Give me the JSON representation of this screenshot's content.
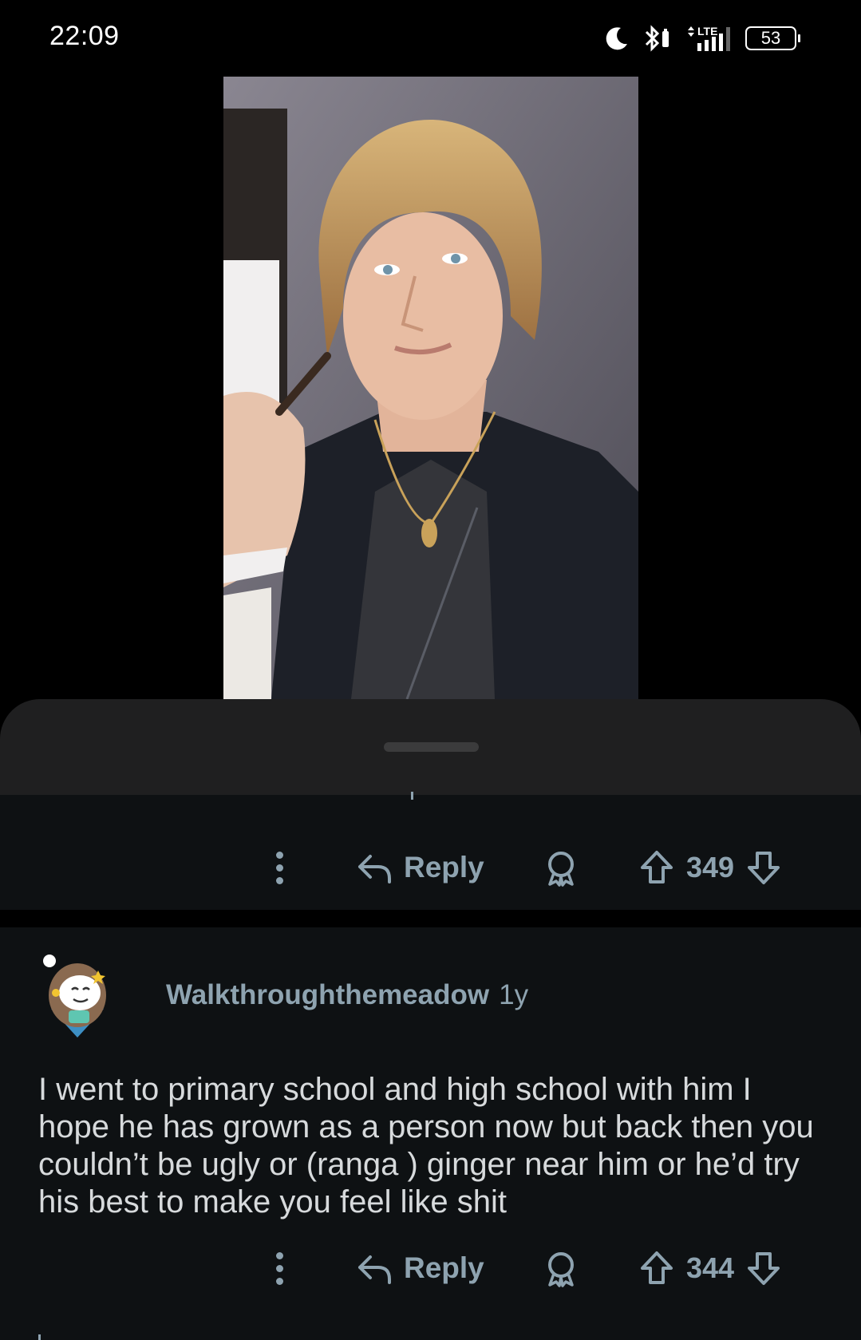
{
  "status_bar": {
    "time": "22:09",
    "network": "LTE",
    "battery": "53",
    "icons": [
      "moon-icon",
      "bluetooth-icon",
      "signal-icon",
      "battery-icon"
    ]
  },
  "media": {
    "icon": "photo"
  },
  "comments": [
    {
      "actions": {
        "reply_label": "Reply",
        "score": "349"
      }
    },
    {
      "author": "Walkthroughthemeadow",
      "age": "1y",
      "body": "I went to primary school and high school with him I hope he has grown as a person now but back then you couldn’t be ugly or (ranga ) ginger near him or he’d try his best to make you feel like shit",
      "actions": {
        "reply_label": "Reply",
        "score": "344"
      }
    }
  ],
  "colors": {
    "background": "#000000",
    "comment_bg": "#0e1113",
    "sheet_bg": "#1f1f20",
    "meta_text": "#8ea3b0",
    "body_text": "#d7dadc"
  }
}
